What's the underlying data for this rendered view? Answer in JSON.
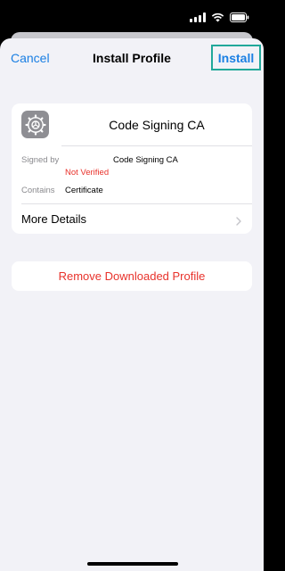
{
  "nav": {
    "cancel_label": "Cancel",
    "title": "Install Profile",
    "install_label": "Install"
  },
  "profile": {
    "name": "Code Signing CA",
    "icon": "gear-icon",
    "signed_by_label": "Signed by",
    "signed_by_value": "Code Signing CA",
    "verification_status": "Not Verified",
    "contains_label": "Contains",
    "contains_value": "Certificate",
    "more_details_label": "More Details"
  },
  "actions": {
    "remove_label": "Remove Downloaded Profile"
  },
  "colors": {
    "accent": "#1a7fe3",
    "destructive": "#e8322b",
    "highlight_border": "#21a89a",
    "background": "#f2f2f7"
  }
}
